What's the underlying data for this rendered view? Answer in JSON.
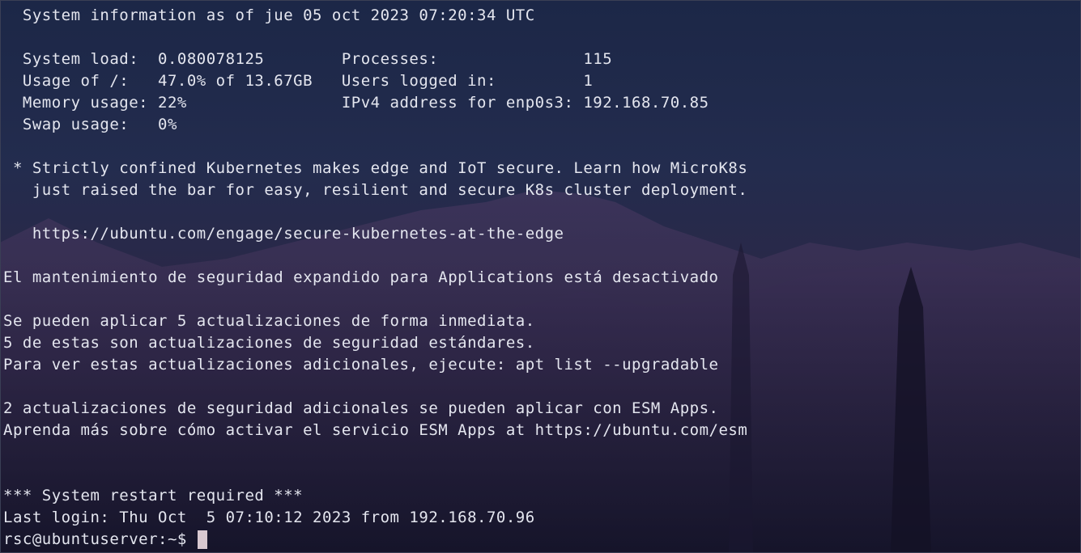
{
  "terminal": {
    "lines": [
      "  System information as of jue 05 oct 2023 07:20:34 UTC",
      "",
      "  System load:  0.080078125        Processes:               115",
      "  Usage of /:   47.0% of 13.67GB   Users logged in:         1",
      "  Memory usage: 22%                IPv4 address for enp0s3: 192.168.70.85",
      "  Swap usage:   0%",
      "",
      " * Strictly confined Kubernetes makes edge and IoT secure. Learn how MicroK8s",
      "   just raised the bar for easy, resilient and secure K8s cluster deployment.",
      "",
      "   https://ubuntu.com/engage/secure-kubernetes-at-the-edge",
      "",
      "El mantenimiento de seguridad expandido para Applications está desactivado",
      "",
      "Se pueden aplicar 5 actualizaciones de forma inmediata.",
      "5 de estas son actualizaciones de seguridad estándares.",
      "Para ver estas actualizaciones adicionales, ejecute: apt list --upgradable",
      "",
      "2 actualizaciones de seguridad adicionales se pueden aplicar con ESM Apps.",
      "Aprenda más sobre cómo activar el servicio ESM Apps at https://ubuntu.com/esm",
      "",
      "",
      "*** System restart required ***",
      "Last login: Thu Oct  5 07:10:12 2023 from 192.168.70.96",
      "rsc@ubuntuserver:~$ "
    ]
  },
  "colors": {
    "text": "#e4e6ef",
    "cursor": "#d8c8d0",
    "background_top": "#1c2747",
    "background_bottom": "#111225"
  }
}
